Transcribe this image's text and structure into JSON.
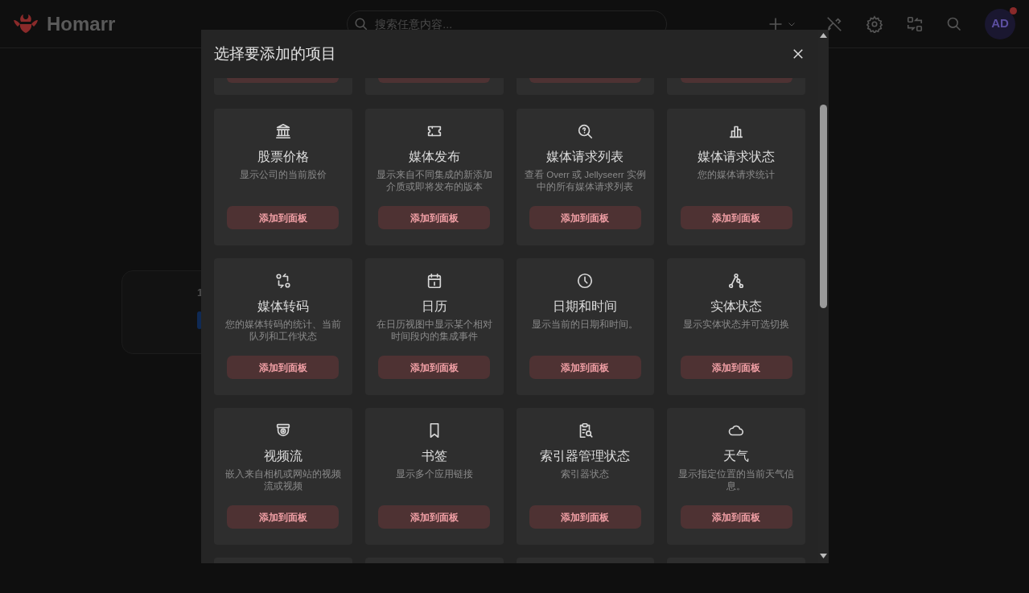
{
  "header": {
    "brand": "Homarr",
    "search": {
      "placeholder": "搜索任意内容..."
    },
    "avatar": "AD",
    "notification": true
  },
  "background_card": {
    "text": "1"
  },
  "dialog": {
    "title": "选择要添加的项目",
    "items": [
      {
        "title": "股票价格",
        "description": "显示公司的当前股价",
        "button": "添加到面板"
      },
      {
        "title": "媒体发布",
        "description": "显示来自不同集成的新添加介质或即将发布的版本",
        "button": "添加到面板"
      },
      {
        "title": "媒体请求列表",
        "description": "查看 Overr 或 Jellyseerr 实例中的所有媒体请求列表",
        "button": "添加到面板"
      },
      {
        "title": "媒体请求状态",
        "description": "您的媒体请求统计",
        "button": "添加到面板"
      },
      {
        "title": "媒体转码",
        "description": "您的媒体转码的统计、当前队列和工作状态",
        "button": "添加到面板"
      },
      {
        "title": "日历",
        "description": "在日历视图中显示某个相对时间段内的集成事件",
        "button": "添加到面板"
      },
      {
        "title": "日期和时间",
        "description": "显示当前的日期和时间。",
        "button": "添加到面板"
      },
      {
        "title": "实体状态",
        "description": "显示实体状态并可选切换",
        "button": "添加到面板"
      },
      {
        "title": "视频流",
        "description": "嵌入来自相机或网站的视频流或视频",
        "button": "添加到面板"
      },
      {
        "title": "书签",
        "description": "显示多个应用链接",
        "button": "添加到面板"
      },
      {
        "title": "索引器管理状态",
        "description": "索引器状态",
        "button": "添加到面板"
      },
      {
        "title": "天气",
        "description": "显示指定位置的当前天气信息。",
        "button": "添加到面板"
      }
    ]
  }
}
